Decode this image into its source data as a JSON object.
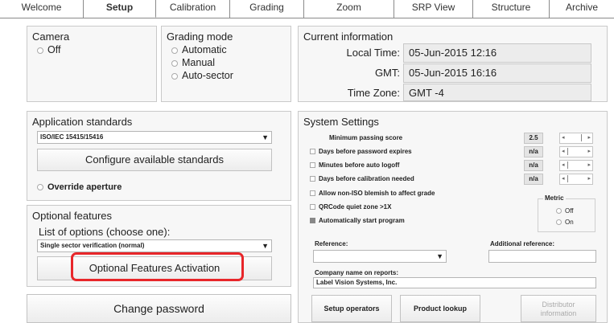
{
  "tabs": [
    "Welcome",
    "Setup",
    "Calibration",
    "Grading",
    "Zoom",
    "SRP View",
    "Structure",
    "Archive"
  ],
  "active_tab": "Setup",
  "camera": {
    "title": "Camera",
    "option": "Off"
  },
  "grading_mode": {
    "title": "Grading mode",
    "options": [
      "Automatic",
      "Manual",
      "Auto-sector"
    ]
  },
  "current_info": {
    "title": "Current information",
    "local_time_label": "Local Time:",
    "local_time": "05-Jun-2015 12:16",
    "gmt_label": "GMT:",
    "gmt": "05-Jun-2015 16:16",
    "timezone_label": "Time Zone:",
    "timezone": "GMT -4"
  },
  "app_standards": {
    "title": "Application standards",
    "selected": "ISO/IEC 15415/15416",
    "configure_button": "Configure available standards",
    "override_label": "Override aperture"
  },
  "optional_features": {
    "title": "Optional features",
    "list_label": "List of options (choose one):",
    "selected": "Single sector verification (normal)",
    "activation_button": "Optional Features Activation"
  },
  "change_password_button": "Change password",
  "system_settings": {
    "title": "System Settings",
    "min_score_label": "Minimum passing score",
    "min_score": "2.5",
    "pw_expire_label": "Days before password expires",
    "pw_expire": "n/a",
    "auto_logoff_label": "Minutes before auto logoff",
    "auto_logoff": "n/a",
    "calibration_label": "Days before calibration needed",
    "calibration": "n/a",
    "blemish_label": "Allow non-ISO blemish to affect grade",
    "qrcode_label": "QRCode quiet zone >1X",
    "autostart_label": "Automatically start program",
    "metric_title": "Metric",
    "metric_off": "Off",
    "metric_on": "On",
    "reference_label": "Reference:",
    "additional_reference_label": "Additional reference:",
    "company_label": "Company name on reports:",
    "company_value": "Label Vision Systems, Inc.",
    "setup_operators_button": "Setup operators",
    "product_lookup_button": "Product lookup",
    "distributor_button_line1": "Distributor",
    "distributor_button_line2": "information"
  },
  "colors": {
    "highlight": "#e8262a"
  }
}
